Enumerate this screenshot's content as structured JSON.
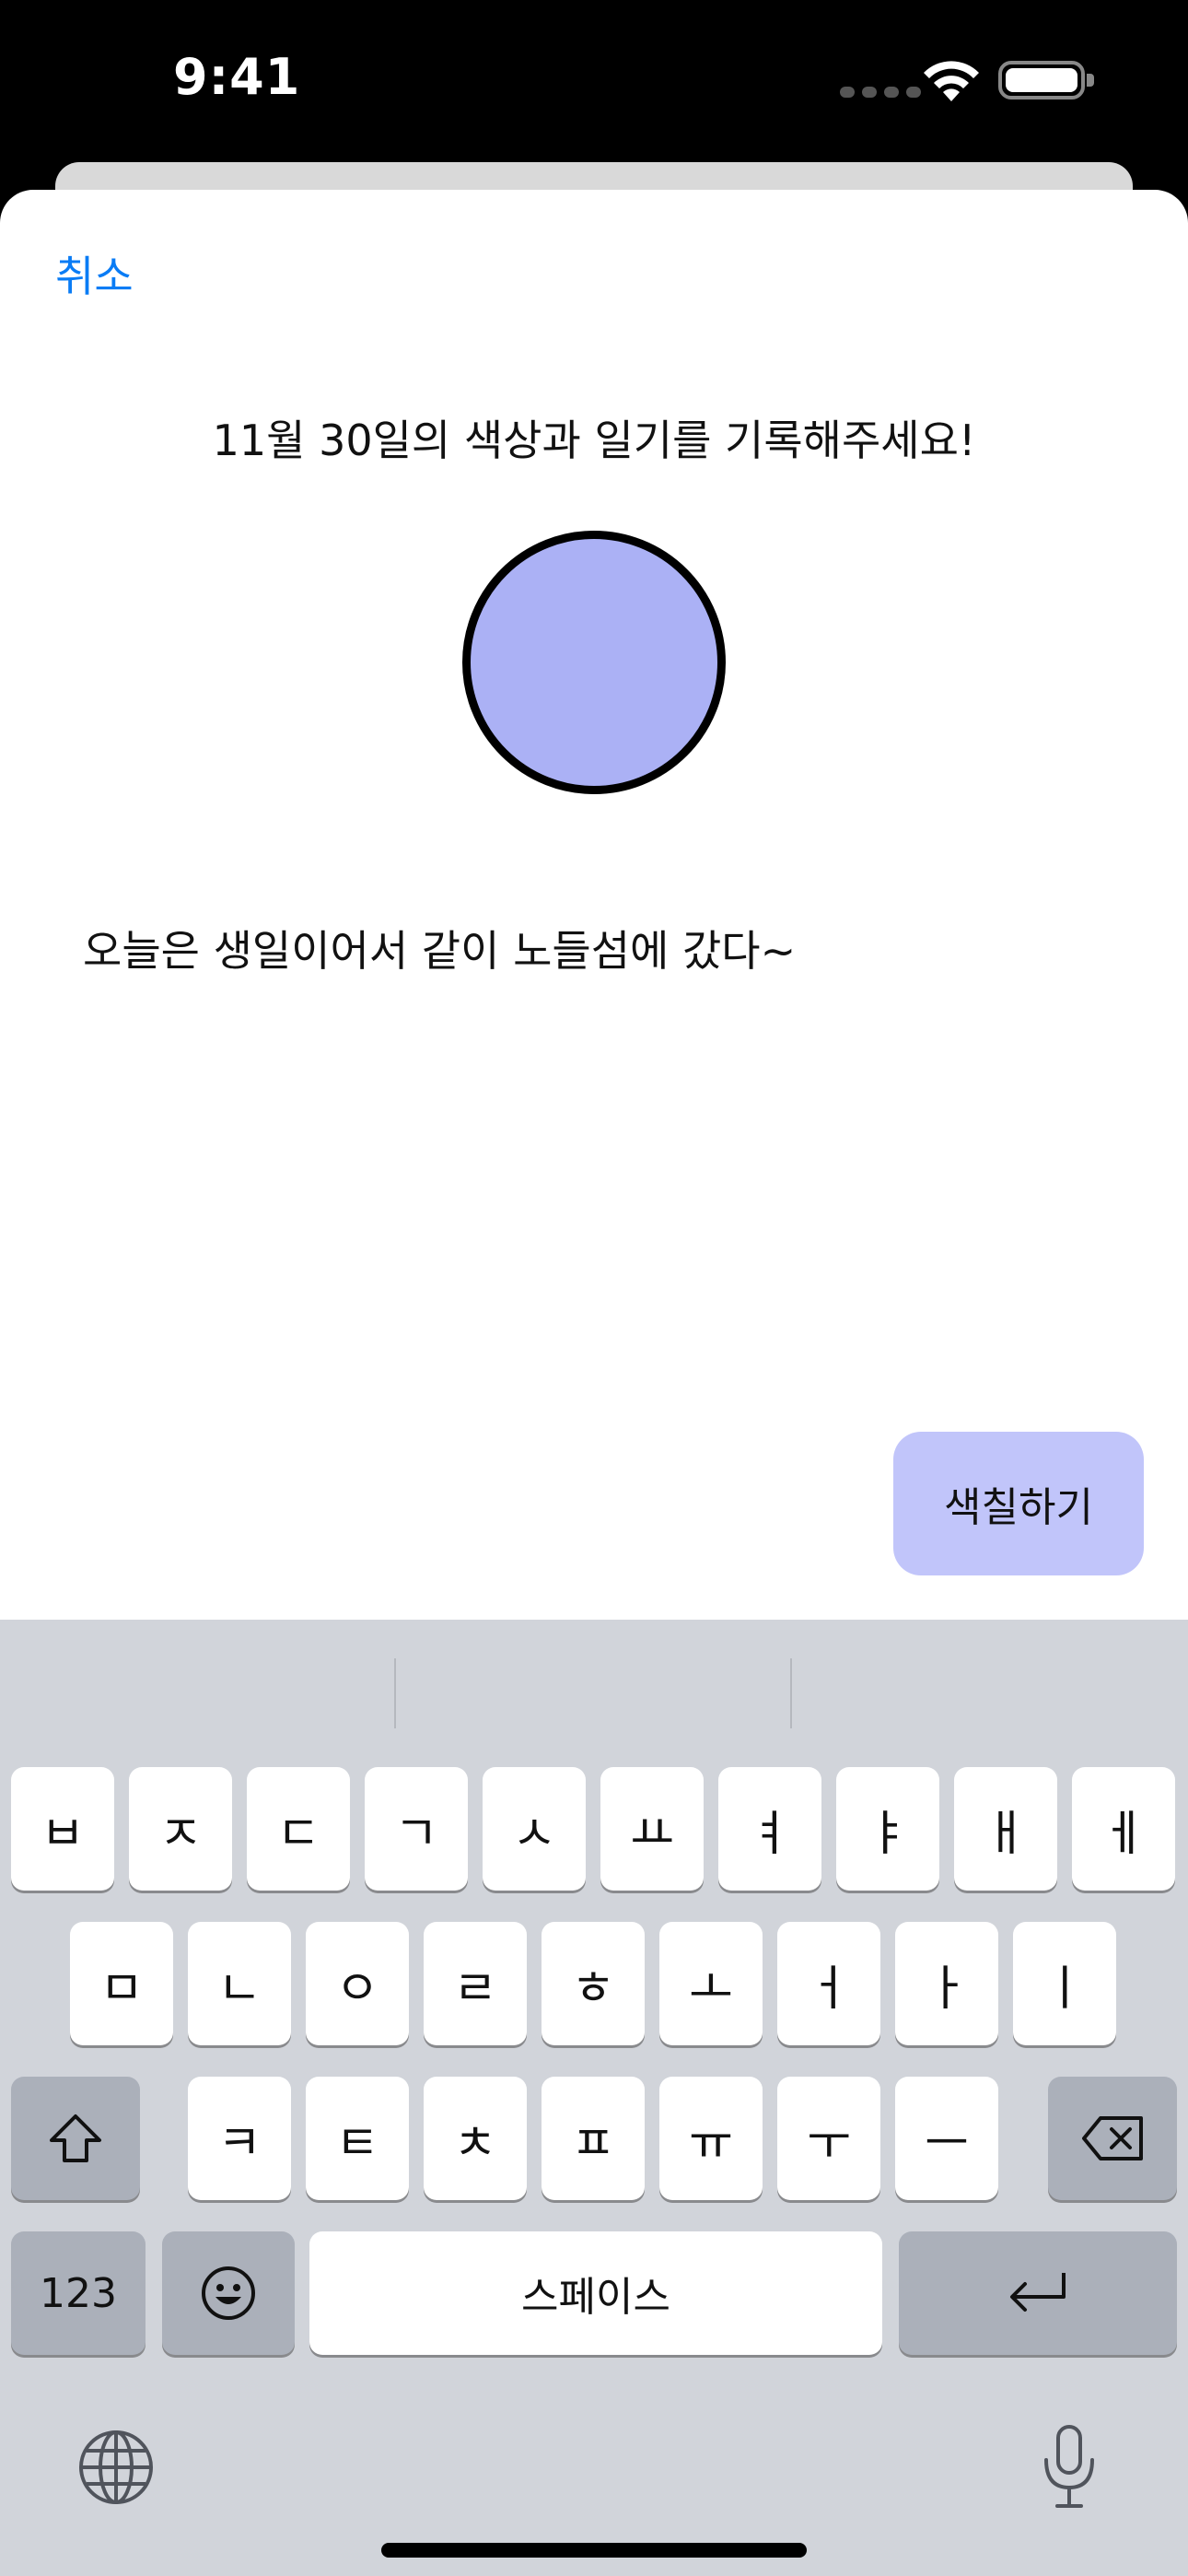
{
  "status_bar": {
    "time": "9:41"
  },
  "sheet": {
    "cancel_label": "취소",
    "title": "11월 30일의 색상과 일기를 기록해주세요!",
    "selected_color": "#abb1f5",
    "diary_text": "오늘은 생일이어서 같이 노들섬에 갔다~",
    "paint_button_label": "색칠하기",
    "paint_button_color": "#c1c5fa",
    "accent_color": "#0a7cf5"
  },
  "keyboard": {
    "row1": [
      "ㅂ",
      "ㅈ",
      "ㄷ",
      "ㄱ",
      "ㅅ",
      "ㅛ",
      "ㅕ",
      "ㅑ",
      "ㅐ",
      "ㅔ"
    ],
    "row2": [
      "ㅁ",
      "ㄴ",
      "ㅇ",
      "ㄹ",
      "ㅎ",
      "ㅗ",
      "ㅓ",
      "ㅏ",
      "ㅣ"
    ],
    "row3": [
      "ㅋ",
      "ㅌ",
      "ㅊ",
      "ㅍ",
      "ㅠ",
      "ㅜ",
      "ㅡ"
    ],
    "numbers_label": "123",
    "space_label": "스페이스",
    "icons": {
      "shift": "shift-icon",
      "delete": "delete-icon",
      "emoji": "emoji-icon",
      "return": "return-icon",
      "globe": "globe-icon",
      "mic": "mic-icon"
    }
  }
}
